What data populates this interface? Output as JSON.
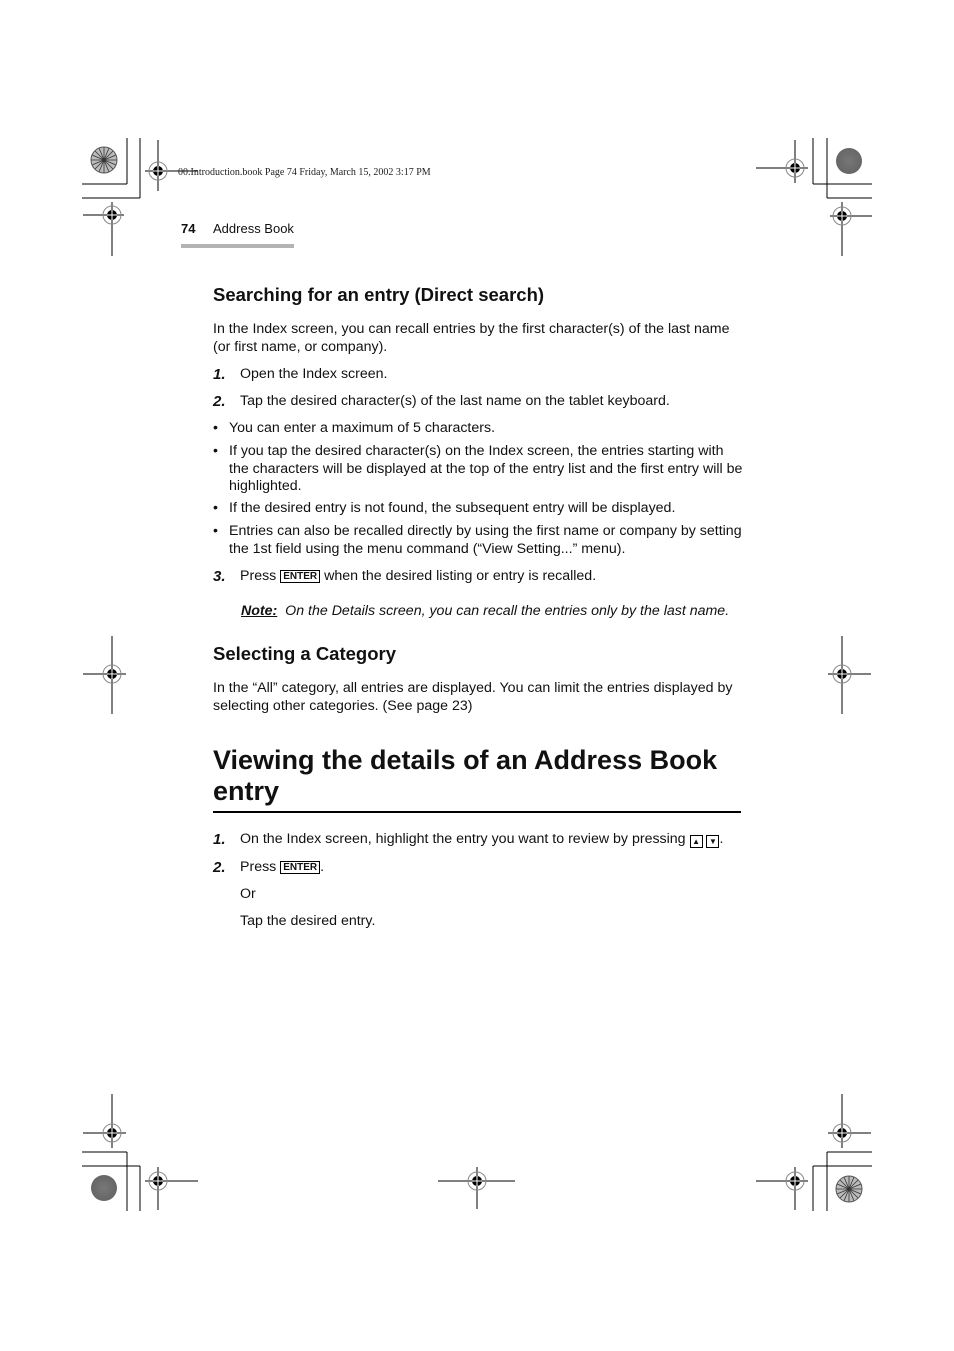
{
  "slug": {
    "text": "00.Introduction.book  Page 74  Friday, March 15, 2002  3:17 PM"
  },
  "running_header": {
    "page_number": "74",
    "section": "Address Book"
  },
  "section1": {
    "heading": "Searching for an entry (Direct search)",
    "intro": "In the Index screen, you can recall entries by the first character(s) of the last name (or first name, or company).",
    "steps": [
      {
        "num": "1.",
        "text": "Open the Index screen."
      },
      {
        "num": "2.",
        "text": "Tap the desired character(s) of the last name on the tablet keyboard."
      }
    ],
    "bullets": [
      {
        "marker": "•",
        "text": "You can enter a maximum of 5 characters."
      },
      {
        "marker": "•",
        "text": "If you tap the desired character(s) on the Index screen, the entries starting with the characters will be displayed at the top of the entry list and the first entry will be highlighted."
      },
      {
        "marker": "•",
        "text": "If the desired entry is not found, the subsequent entry will be displayed."
      },
      {
        "marker": "•",
        "text": "Entries can also be recalled directly by using the first name or company by setting the 1st field using the menu command (“View Setting...” menu)."
      }
    ],
    "step3": {
      "num": "3.",
      "pre": "Press ",
      "key": "ENTER",
      "post": " when the desired listing or entry is recalled."
    },
    "note": {
      "label": "Note:",
      "text": "On the Details screen, you can recall the entries only by the last name."
    }
  },
  "section2": {
    "heading": "Selecting a Category",
    "body": "In the “All” category, all entries are displayed. You can limit the entries displayed by selecting other categories. (See page 23)"
  },
  "section3": {
    "heading": "Viewing the details of an Address Book entry",
    "step1": {
      "num": "1.",
      "text": "On the Index screen, highlight the entry you want to review by pressing ",
      "key_up": "▲",
      "key_down": "▼",
      "end": "."
    },
    "step2": {
      "num": "2.",
      "pre": "Press ",
      "key": "ENTER",
      "end": "."
    },
    "or": "Or",
    "alt": "Tap the desired entry."
  }
}
